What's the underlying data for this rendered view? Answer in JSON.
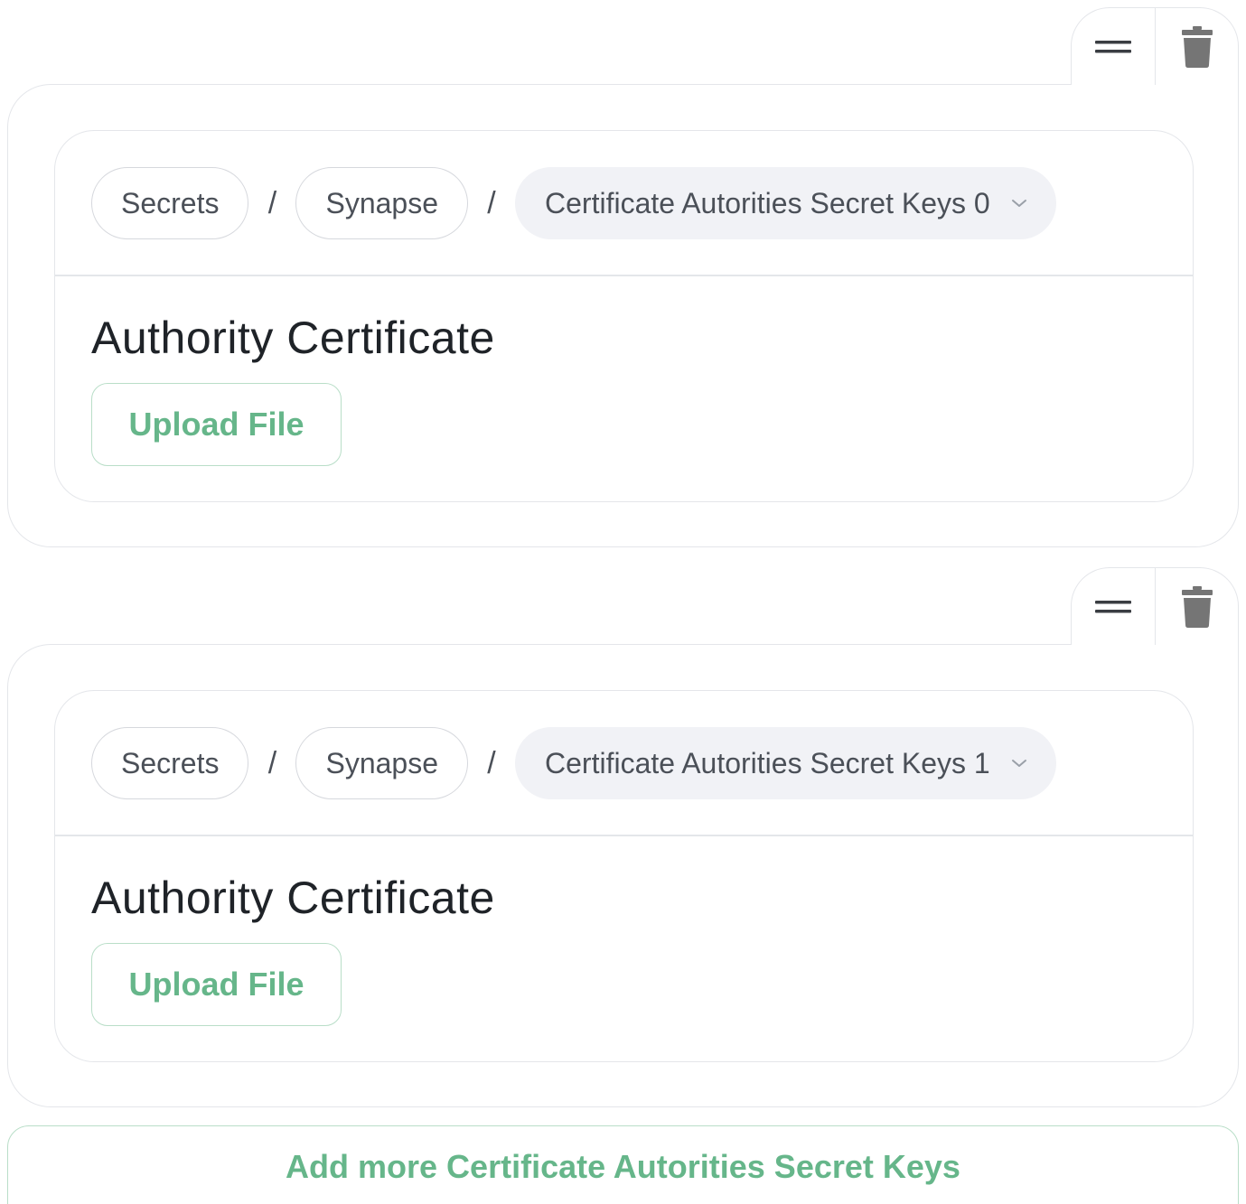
{
  "icons": {
    "drag": "drag-handle-icon",
    "delete": "trash-icon",
    "dropdown": "chevron-down-icon"
  },
  "colors": {
    "accent_green": "#66b68a",
    "accent_border": "#b9dec8",
    "border": "#e4e6ea",
    "select_bg": "#f1f2f6"
  },
  "items": [
    {
      "breadcrumb": {
        "root": "Secrets",
        "parent": "Synapse",
        "separator": "/",
        "current": "Certificate Autorities Secret Keys 0"
      },
      "field_title": "Authority Certificate",
      "upload_label": "Upload File"
    },
    {
      "breadcrumb": {
        "root": "Secrets",
        "parent": "Synapse",
        "separator": "/",
        "current": "Certificate Autorities Secret Keys 1"
      },
      "field_title": "Authority Certificate",
      "upload_label": "Upload File"
    }
  ],
  "add_more_label": "Add more Certificate Autorities Secret Keys"
}
